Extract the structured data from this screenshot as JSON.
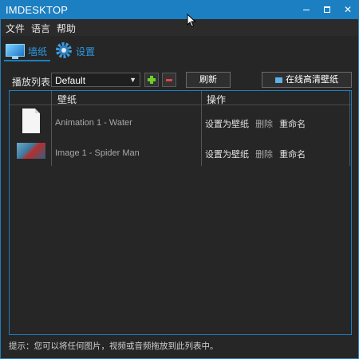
{
  "window": {
    "title": "IMDESKTOP",
    "controls": {
      "minimize": "",
      "maximize": "",
      "close": "✕"
    }
  },
  "menu": [
    "文件",
    "语言",
    "帮助"
  ],
  "tabs": [
    {
      "label": "墙纸",
      "icon": "monitor-icon",
      "active": true
    },
    {
      "label": "设置",
      "icon": "gear-icon",
      "active": false
    }
  ],
  "toolbar": {
    "playlist_label": "播放列表：",
    "playlist_value": "Default",
    "refresh_label": "刷新",
    "online_label": "在线高清壁纸"
  },
  "table": {
    "headers": [
      "壁纸",
      "操作"
    ],
    "rows": [
      {
        "name": "Animation 1 - Water",
        "thumb": "file-icon"
      },
      {
        "name": "Image 1 - Spider Man",
        "thumb": "image-thumbnail"
      }
    ],
    "actions": [
      "设置为壁纸",
      "删除",
      "重命名"
    ]
  },
  "hint": "提示：您可以将任何图片，视频或音频拖放到此列表中。",
  "colors": {
    "accent": "#1c7fc1",
    "background": "#262626",
    "add": "#6ccf2a",
    "remove": "#e04444"
  }
}
